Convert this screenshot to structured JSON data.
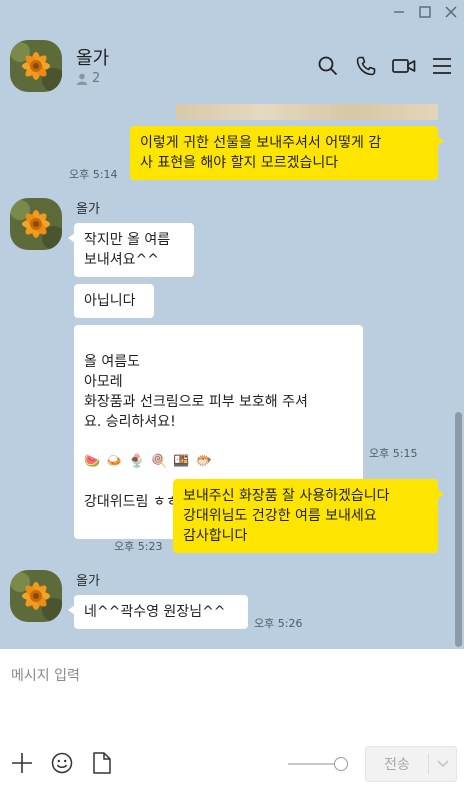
{
  "window": {
    "minimize_icon": "minimize-icon",
    "maximize_icon": "maximize-icon",
    "close_icon": "close-icon"
  },
  "header": {
    "title": "올가",
    "member_count": "2",
    "icons": [
      "search-icon",
      "phone-icon",
      "video-call-icon",
      "menu-icon"
    ]
  },
  "messages": [
    {
      "sender": "me",
      "text": "이렇게 귀한 선물을 보내주셔서 어떻게 감\n사 표현을 해야 할지 모르겠습니다",
      "time": "오후 5:14"
    },
    {
      "sender": "other",
      "name": "올가",
      "text": "작지만 올 여름\n보내셔요^^"
    },
    {
      "sender": "other",
      "text": "아닙니다"
    },
    {
      "sender": "other",
      "text": "올 여름도\n아모레\n화장품과 선크림으로 피부 보호해 주셔\n요. 승리하셔요!",
      "emoji_line": "🍉 🍛 🍨 🍭 🍱 🐡",
      "last_line": "강대위드림 ㅎㅎ",
      "time": "오후 5:15"
    },
    {
      "sender": "me",
      "text": "보내주신 화장품 잘 사용하겠습니다\n강대위님도 건강한 여름 보내세요\n감사합니다",
      "time": "오후 5:23"
    },
    {
      "sender": "other",
      "name": "올가",
      "text": "네^^곽수영 원장님^^",
      "time": "오후 5:26"
    }
  ],
  "input": {
    "placeholder": "메시지 입력"
  },
  "toolbar": {
    "icons": [
      "plus-icon",
      "emoji-icon",
      "file-icon"
    ],
    "send_label": "전송"
  },
  "colors": {
    "background": "#bacee0",
    "my_bubble": "#fee500",
    "other_bubble": "#ffffff"
  }
}
